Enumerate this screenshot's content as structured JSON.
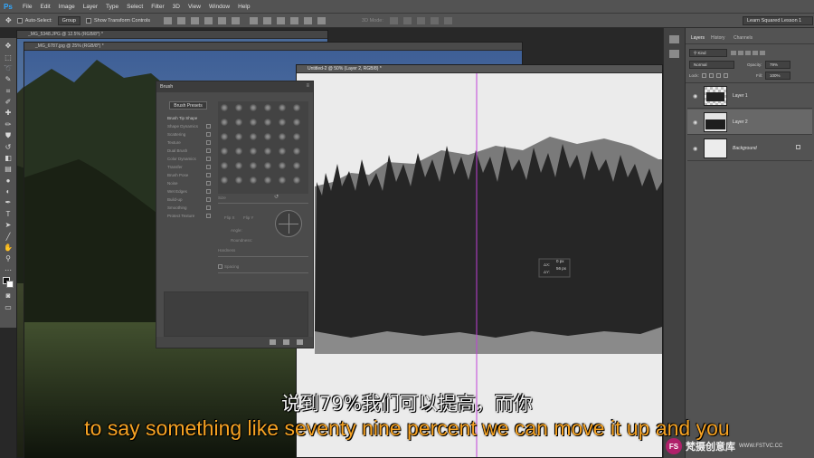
{
  "menubar": {
    "logo": "Ps",
    "items": [
      "File",
      "Edit",
      "Image",
      "Layer",
      "Type",
      "Select",
      "Filter",
      "3D",
      "View",
      "Window",
      "Help"
    ]
  },
  "options": {
    "auto_select": "Auto-Select:",
    "group": "Group",
    "show_transform": "Show Transform Controls",
    "mode_3d": "3D Mode:",
    "workspace": "Learn Squared Lesson 1"
  },
  "documents": [
    {
      "title": "_MG_5348.JPG @ 12.5% (RGB/8*) *"
    },
    {
      "title": "_MG_6787.jpg @ 25% (RGB/8*) *"
    },
    {
      "title": "Untitled-2 @ 50% (Layer 2, RGB/8) *"
    }
  ],
  "brush": {
    "title": "Brush",
    "presets_button": "Brush Presets",
    "options": [
      "Brush Tip Shape",
      "Shape Dynamics",
      "Scattering",
      "Texture",
      "Dual Brush",
      "Color Dynamics",
      "Transfer",
      "Brush Pose",
      "Noise",
      "Wet Edges",
      "Build-up",
      "Smoothing",
      "Protect Texture"
    ],
    "size_label": "Size",
    "flip_x": "Flip X",
    "flip_y": "Flip Y",
    "angle": "Angle:",
    "roundness": "Roundness:",
    "hardness": "Hardness",
    "spacing": "Spacing"
  },
  "readout": {
    "dx": "0 px",
    "dy": "56 px"
  },
  "layers": {
    "tabs": [
      "Layers",
      "History",
      "Channels"
    ],
    "kind": "Kind",
    "blend_mode": "Normal",
    "opacity_label": "Opacity:",
    "opacity_value": "79%",
    "lock_label": "Lock:",
    "fill_label": "Fill:",
    "fill_value": "100%",
    "items": [
      {
        "name": "Layer 1"
      },
      {
        "name": "Layer 2"
      },
      {
        "name": "Background"
      }
    ]
  },
  "subtitles": {
    "chinese": "说到79%我们可以提高，而你",
    "english": "to say something like seventy nine percent we can move it up and you"
  },
  "watermark": {
    "brand": "梵摄创意库",
    "url": "WWW.FSTVC.CC"
  }
}
